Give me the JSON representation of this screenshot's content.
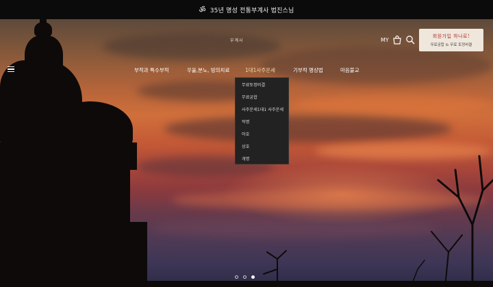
{
  "topbar": {
    "symbol": "ॐ",
    "text": "35년 명성 전통부계사 법진스님"
  },
  "header": {
    "logo": "부계사",
    "my_label": "MY",
    "promo": {
      "line1": "회원가입 하나로!",
      "line2": "무료궁합 & 무료 토정비결"
    }
  },
  "nav": {
    "items": [
      "부적과 특수부적",
      "우울,분노, 빙의치료",
      "1대1사주운세",
      "기부적 명상법",
      "마음불교"
    ],
    "active_index": 2
  },
  "dropdown": {
    "items": [
      "무료토정비결",
      "무료궁합",
      "사주운세1대1 사주운세",
      "작명",
      "아호",
      "상호",
      "개명"
    ]
  },
  "slider": {
    "total": 3,
    "active_index": 2
  },
  "colors": {
    "topbar_bg": "#0b0b0b",
    "dropdown_bg": "#222222",
    "promo_bg": "#efe7dc",
    "promo_accent": "#b0302a"
  }
}
